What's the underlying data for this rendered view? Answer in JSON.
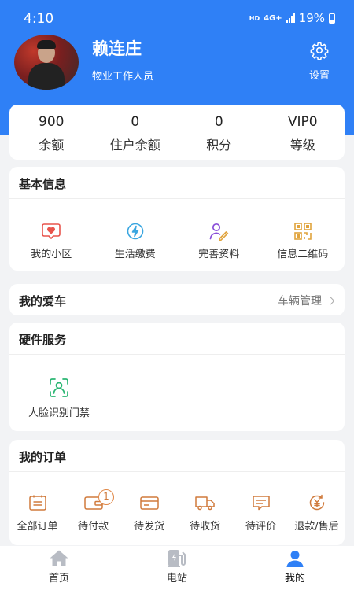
{
  "status_bar": {
    "time": "4:10",
    "hd": "HD",
    "network": "4G+",
    "battery": "19%"
  },
  "profile": {
    "name": "赖连庄",
    "role": "物业工作人员",
    "settings_label": "设置"
  },
  "stats": [
    {
      "value": "900",
      "label": "余额"
    },
    {
      "value": "0",
      "label": "住户余额"
    },
    {
      "value": "0",
      "label": "积分"
    },
    {
      "value": "VIP0",
      "label": "等级"
    }
  ],
  "basic_info": {
    "title": "基本信息",
    "items": [
      {
        "label": "我的小区",
        "icon": "community-heart-icon",
        "color": "#e8544c"
      },
      {
        "label": "生活缴费",
        "icon": "payment-water-icon",
        "color": "#3aa6e0"
      },
      {
        "label": "完善资料",
        "icon": "edit-profile-icon",
        "color": "#8a4fd8"
      },
      {
        "label": "信息二维码",
        "icon": "qr-code-icon",
        "color": "#e0a33c"
      }
    ]
  },
  "my_car": {
    "title": "我的爱车",
    "link_label": "车辆管理"
  },
  "hardware": {
    "title": "硬件服务",
    "items": [
      {
        "label": "人脸识别门禁",
        "icon": "face-recognition-icon",
        "color": "#2bb673"
      }
    ]
  },
  "orders": {
    "title": "我的订单",
    "items": [
      {
        "label": "全部订单",
        "icon": "all-orders-icon"
      },
      {
        "label": "待付款",
        "icon": "wallet-icon",
        "badge": "1"
      },
      {
        "label": "待发货",
        "icon": "card-icon"
      },
      {
        "label": "待收货",
        "icon": "truck-icon"
      },
      {
        "label": "待评价",
        "icon": "comment-icon"
      },
      {
        "label": "退款/售后",
        "icon": "refund-icon"
      }
    ],
    "icon_color": "#d07a3c"
  },
  "tabbar": {
    "items": [
      {
        "label": "首页",
        "icon": "home-icon"
      },
      {
        "label": "电站",
        "icon": "charging-station-icon"
      },
      {
        "label": "我的",
        "icon": "profile-icon",
        "active": true
      }
    ]
  },
  "colors": {
    "primary": "#2f80f6",
    "background": "#f2f3f5"
  }
}
